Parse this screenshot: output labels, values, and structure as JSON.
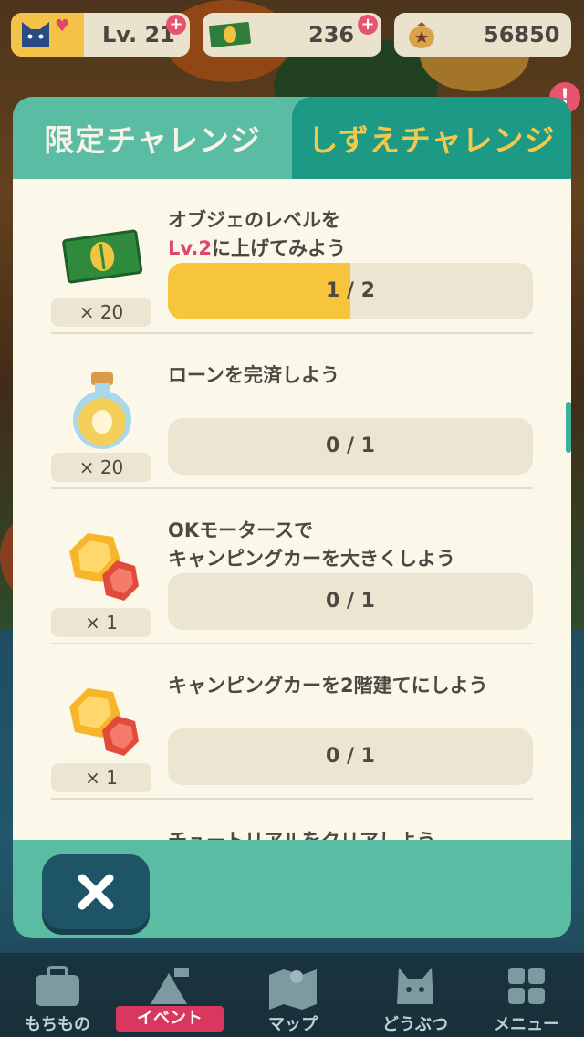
{
  "hud": {
    "level": "Lv. 21",
    "tickets": "236",
    "bells": "56850",
    "alert": "!"
  },
  "tabs": [
    {
      "label": "限定チャレンジ",
      "active": false
    },
    {
      "label": "しずえチャレンジ",
      "active": true
    }
  ],
  "challenges": [
    {
      "line1": "オブジェのレベルを",
      "line2_highlight": "Lv.2",
      "line2_rest": "に上げてみよう",
      "reward_icon": "leaf-ticket-icon",
      "reward_count": "× 20",
      "progress_text": "1 / 2",
      "progress": 0.5
    },
    {
      "line1": "ローンを完済しよう",
      "line2_highlight": "",
      "line2_rest": "",
      "reward_icon": "essence-bottle-icon",
      "reward_count": "× 20",
      "progress_text": "0 / 1",
      "progress": 0
    },
    {
      "line1": "OKモータースで",
      "line2_highlight": "",
      "line2_rest": "キャンピングカーを大きくしよう",
      "reward_icon": "gem-icon",
      "reward_count": "× 1",
      "progress_text": "0 / 1",
      "progress": 0
    },
    {
      "line1": "キャンピングカーを2階建てにしよう",
      "line2_highlight": "",
      "line2_rest": "",
      "reward_icon": "gem-icon",
      "reward_count": "× 1",
      "progress_text": "0 / 1",
      "progress": 0
    },
    {
      "line1": "チュートリアルをクリアしよう",
      "line2_highlight": "",
      "line2_rest": "",
      "reward_icon": "gem-icon",
      "reward_count": "",
      "progress_text": "",
      "progress": 0
    }
  ],
  "nav": [
    {
      "label": "もちもの",
      "icon": "bag-icon"
    },
    {
      "label": "イベント",
      "icon": "event-icon"
    },
    {
      "label": "マップ",
      "icon": "map-icon"
    },
    {
      "label": "どうぶつ",
      "icon": "animal-icon"
    },
    {
      "label": "メニュー",
      "icon": "menu-icon"
    }
  ],
  "colors": {
    "accent": "#5bbca4",
    "tab_active": "#1c9a86",
    "highlight": "#e0466a",
    "progress_fill": "#f7c53c"
  }
}
